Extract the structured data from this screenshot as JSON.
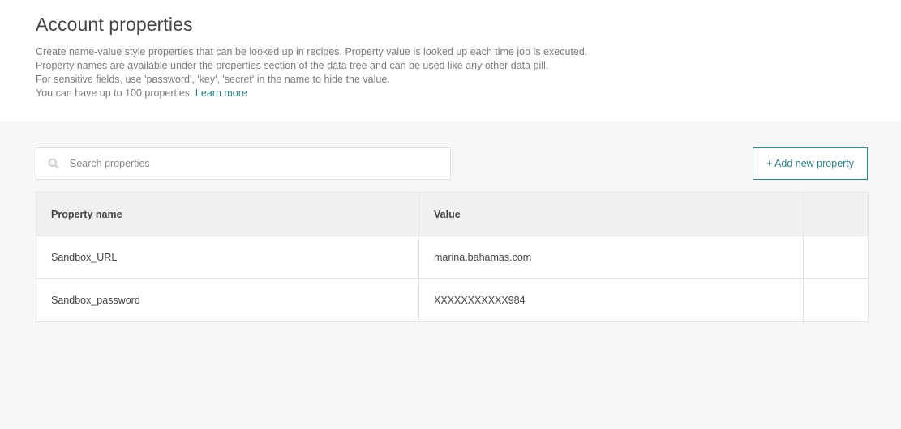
{
  "header": {
    "title": "Account properties",
    "description": [
      "Create name-value style properties that can be looked up in recipes. Property value is looked up each time job is executed.",
      "Property names are available under the properties section of the data tree and can be used like any other data pill.",
      "For sensitive fields, use 'password', 'key', 'secret' in the name to hide the value.",
      "You can have up to 100 properties."
    ],
    "learn_more": "Learn more"
  },
  "search": {
    "placeholder": "Search properties",
    "value": "",
    "icon": "search-icon"
  },
  "toolbar": {
    "add_label": "+ Add new property"
  },
  "table": {
    "columns": [
      "Property name",
      "Value",
      ""
    ],
    "rows": [
      {
        "name": "Sandbox_URL",
        "value": "marina.bahamas.com"
      },
      {
        "name": "Sandbox_password",
        "value": "XXXXXXXXXXX984"
      }
    ]
  },
  "colors": {
    "accent": "#2f7f86",
    "background": "#f7f7f7",
    "header_background": "#ffffff",
    "table_header_background": "#f0f0ee"
  }
}
